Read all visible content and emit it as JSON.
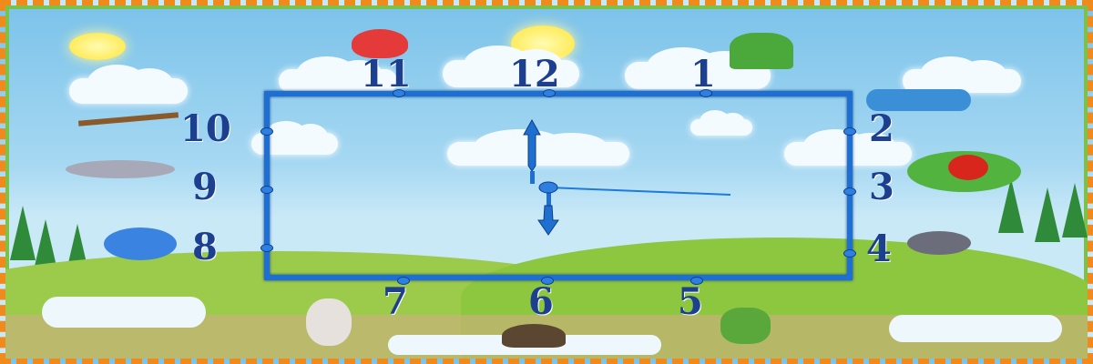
{
  "clock": {
    "numbers": [
      "12",
      "1",
      "2",
      "3",
      "4",
      "5",
      "6",
      "7",
      "8",
      "9",
      "10",
      "11"
    ],
    "time_shown": {
      "hour_hand_points_to": "12",
      "minute_hand_points_to": "6",
      "second_hand_points_to": "3"
    }
  },
  "colors": {
    "frame": "#1f6fd0",
    "numbers": "#1c3f8f",
    "sky": "#a6d8f2",
    "grass": "#8dc63f",
    "border": "#f08a1c"
  }
}
